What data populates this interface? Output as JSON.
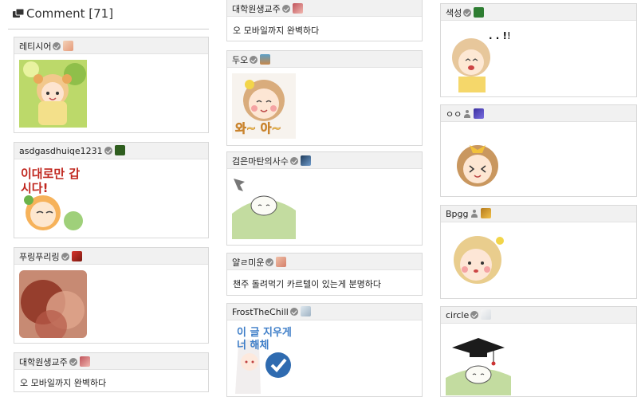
{
  "header": {
    "title": "Comment",
    "count": "[71]"
  },
  "comments": {
    "c1": {
      "author": "레티시어"
    },
    "c2": {
      "author": "asdgasdhuiqe1231"
    },
    "c3": {
      "author": "푸링푸리링"
    },
    "c4": {
      "author": "대학원생교주",
      "text": "오 모바일까지 완벽하다"
    },
    "c5": {
      "author": "대학원생교주",
      "text": "오 모바일까지 완벽하다"
    },
    "c6": {
      "author": "두오"
    },
    "c7": {
      "author": "검은마탄의사수"
    },
    "c8": {
      "author": "얄ㄹ미운",
      "text": "챈주 돌려먹기 카르텔이 있는게 분명하다"
    },
    "c9": {
      "author": "FrostTheChill"
    },
    "c10": {
      "author": "색성"
    },
    "c11": {
      "author": "ㅇㅇ"
    },
    "c12": {
      "author": "Bpgg"
    },
    "c13": {
      "author": "circle"
    }
  },
  "stickers": {
    "s2": {
      "text": "이대로만 갑시다!"
    },
    "s6": {
      "text": "와~ 아~"
    },
    "s9": {
      "text": "이 글 지우게 너 해체"
    },
    "s10": {
      "text": ". . !!"
    }
  },
  "colors": {
    "header_bg": "#f1f1f1",
    "border": "#d9d9d9",
    "badge": "#8a8a8a"
  }
}
